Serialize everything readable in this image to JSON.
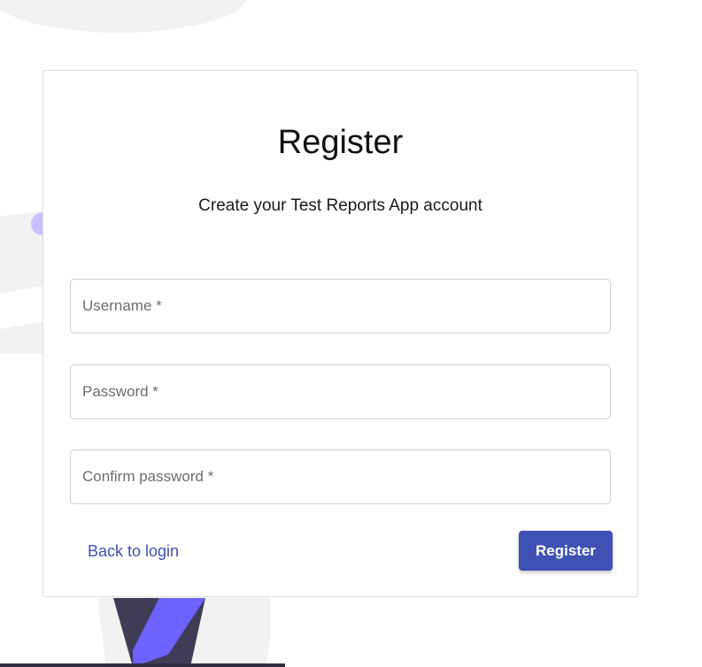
{
  "form": {
    "title": "Register",
    "subtitle": "Create your Test Reports App account",
    "fields": {
      "username": {
        "placeholder": "Username *",
        "value": ""
      },
      "password": {
        "placeholder": "Password *",
        "value": ""
      },
      "confirm_password": {
        "placeholder": "Confirm password *",
        "value": ""
      }
    },
    "back_link_label": "Back to login",
    "register_button_label": "Register"
  },
  "colors": {
    "primary": "#3f51b5",
    "illustration_purple": "#6c63ff",
    "illustration_dark": "#3f3d56",
    "background_shape": "#f2f2f2"
  }
}
